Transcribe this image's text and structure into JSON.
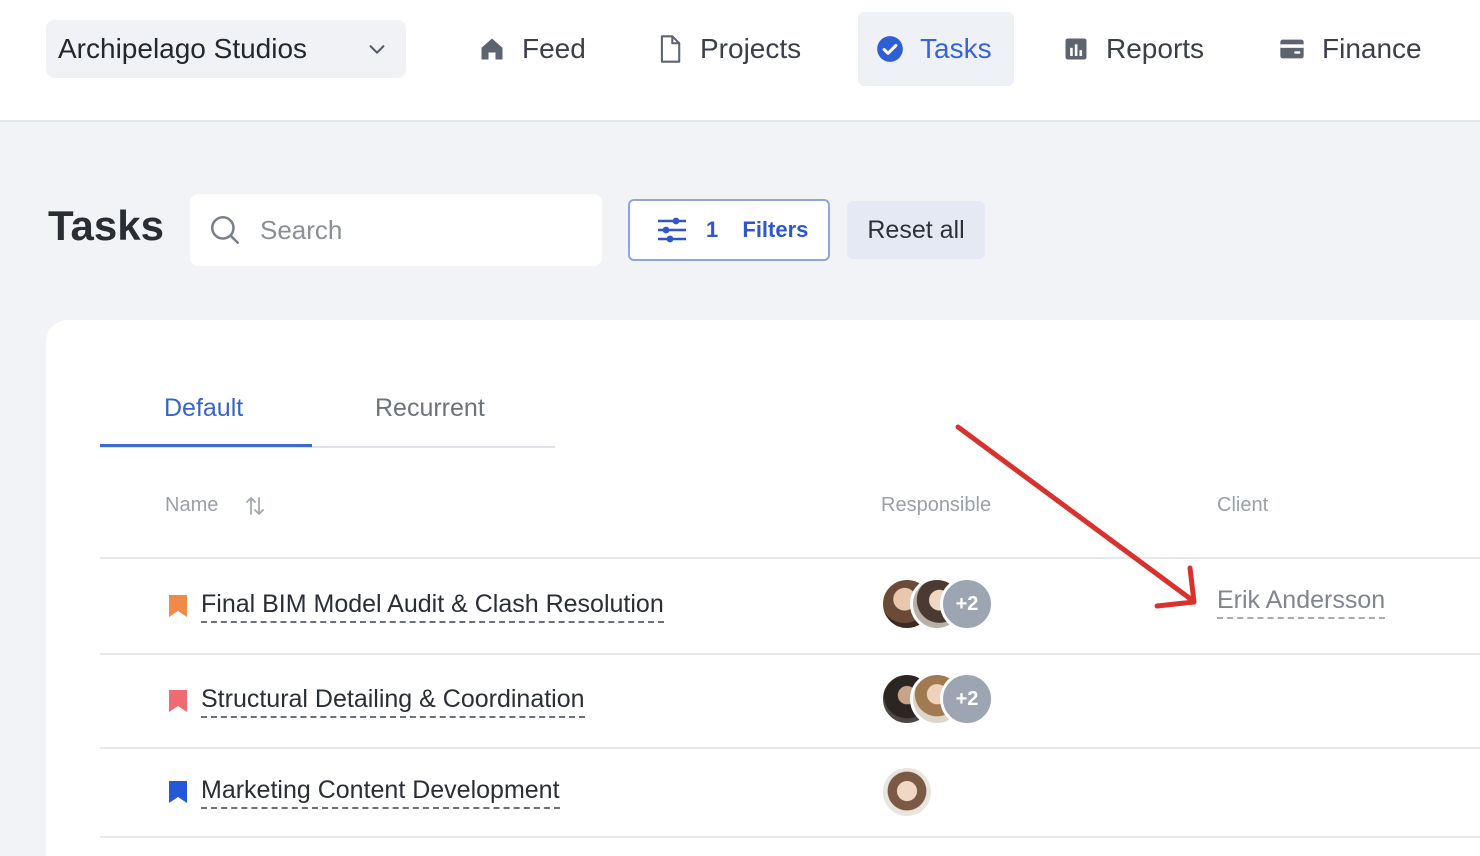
{
  "workspace": {
    "name": "Archipelago Studios",
    "chevron_icon": "chevron-down-icon"
  },
  "nav": {
    "items": [
      {
        "label": "Feed",
        "icon": "home-icon"
      },
      {
        "label": "Projects",
        "icon": "document-icon"
      },
      {
        "label": "Tasks",
        "icon": "check-circle-icon",
        "active": true
      },
      {
        "label": "Reports",
        "icon": "report-icon"
      },
      {
        "label": "Finance",
        "icon": "wallet-icon"
      }
    ]
  },
  "page": {
    "title": "Tasks"
  },
  "search": {
    "placeholder": "Search",
    "icon": "search-icon"
  },
  "filters": {
    "count": "1",
    "label": "Filters",
    "icon": "sliders-icon"
  },
  "reset": {
    "label": "Reset all"
  },
  "tabs": [
    {
      "label": "Default",
      "active": true
    },
    {
      "label": "Recurrent",
      "active": false
    }
  ],
  "table": {
    "columns": {
      "name": "Name",
      "responsible": "Responsible",
      "client": "Client"
    },
    "rows": [
      {
        "name": "Final BIM Model Audit & Clash Resolution",
        "flag_color": "#f08a4b",
        "avatars": 2,
        "more": "+2",
        "client": "Erik Andersson"
      },
      {
        "name": "Structural Detailing & Coordination",
        "flag_color": "#ee6b73",
        "avatars": 2,
        "more": "+2",
        "client": ""
      },
      {
        "name": "Marketing Content Development",
        "flag_color": "#2458d6",
        "avatars": 1,
        "more": "",
        "client": ""
      }
    ]
  },
  "colors": {
    "accent": "#3a63d6",
    "annotation_arrow": "#d9322e"
  }
}
